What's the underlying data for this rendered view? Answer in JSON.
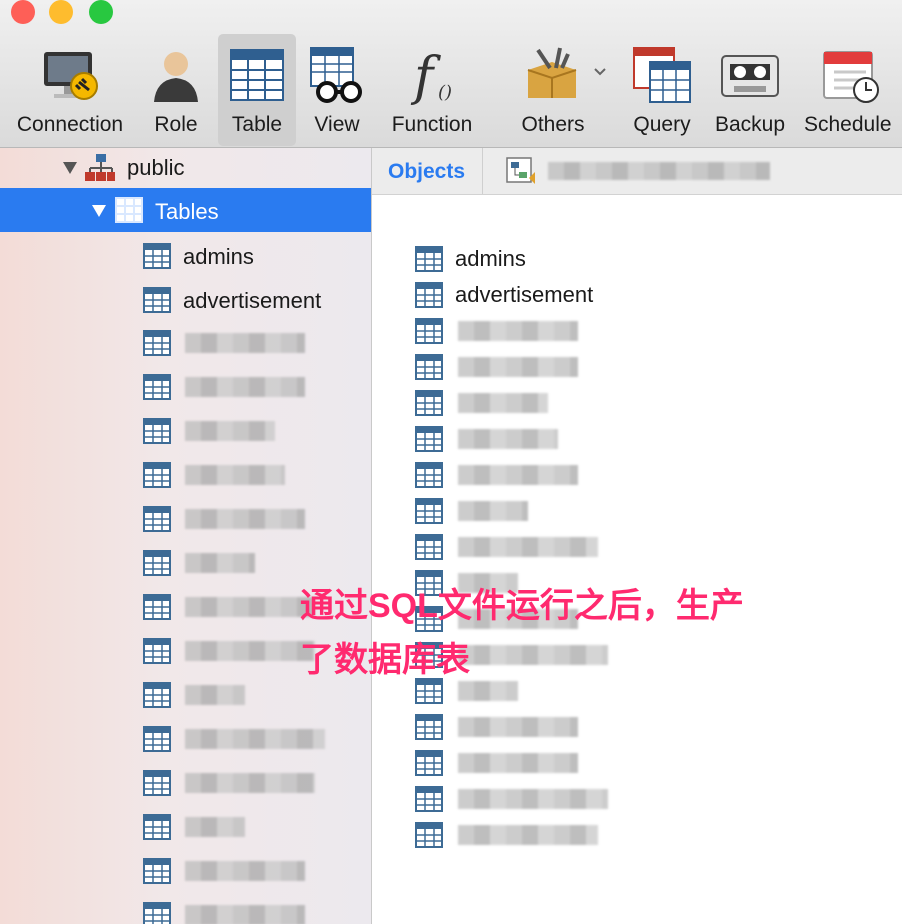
{
  "colors": {
    "accent": "#2a7bf0",
    "annotation": "#ff2a6f"
  },
  "toolbar": {
    "buttons": [
      {
        "label": "Connection",
        "icon": "connection-icon"
      },
      {
        "label": "Role",
        "icon": "role-icon"
      },
      {
        "label": "Table",
        "icon": "table-icon",
        "active": true
      },
      {
        "label": "View",
        "icon": "view-icon"
      },
      {
        "label": "Function",
        "icon": "function-icon"
      },
      {
        "label": "Others",
        "icon": "others-icon"
      },
      {
        "label": "Query",
        "icon": "query-icon"
      },
      {
        "label": "Backup",
        "icon": "backup-icon"
      },
      {
        "label": "Schedule",
        "icon": "schedule-icon"
      }
    ]
  },
  "sidebar": {
    "schema": "public",
    "tables_label": "Tables",
    "items": [
      "admins",
      "advertisement"
    ]
  },
  "tabs": {
    "objects": "Objects"
  },
  "main": {
    "items": [
      "admins",
      "advertisement"
    ]
  },
  "annotation": {
    "line1": "通过SQL文件运行之后，生产",
    "line2": "了数据库表"
  }
}
